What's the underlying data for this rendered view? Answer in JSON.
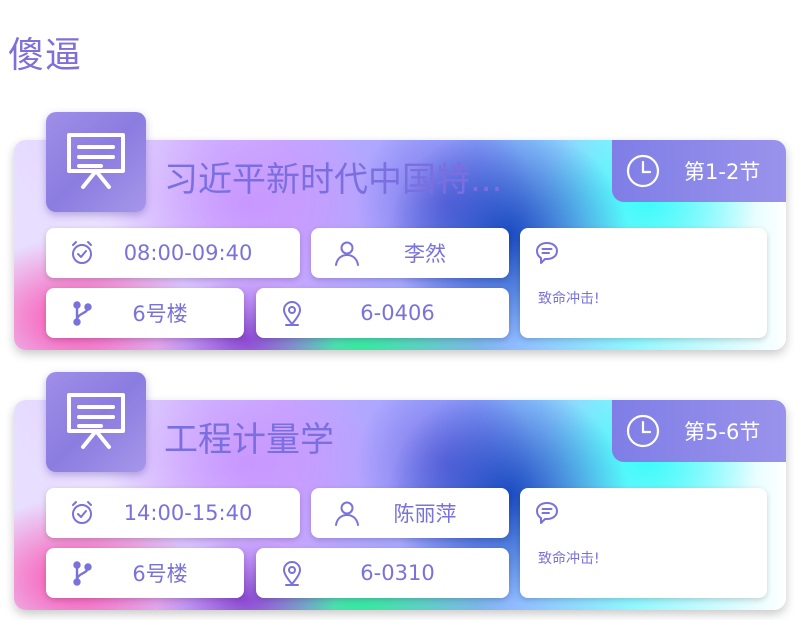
{
  "page": {
    "title": "傻逼"
  },
  "colors": {
    "accent": "#7a72dc",
    "badge": "#8b84e8",
    "card_shadow": "#00000038"
  },
  "icons": {
    "course": "presentation-board-icon",
    "period": "clock-icon",
    "time": "alarm-clock-icon",
    "teacher": "user-icon",
    "building": "branch-icon",
    "room": "location-pin-icon",
    "note": "chat-bubble-icon"
  },
  "courses": [
    {
      "name": "习近平新时代中国特...",
      "period": "第1-2节",
      "time": "08:00-09:40",
      "teacher": "李然",
      "building": "6号楼",
      "room": "6-0406",
      "note": "致命冲击!"
    },
    {
      "name": "工程计量学",
      "period": "第5-6节",
      "time": "14:00-15:40",
      "teacher": "陈丽萍",
      "building": "6号楼",
      "room": "6-0310",
      "note": "致命冲击!"
    }
  ]
}
